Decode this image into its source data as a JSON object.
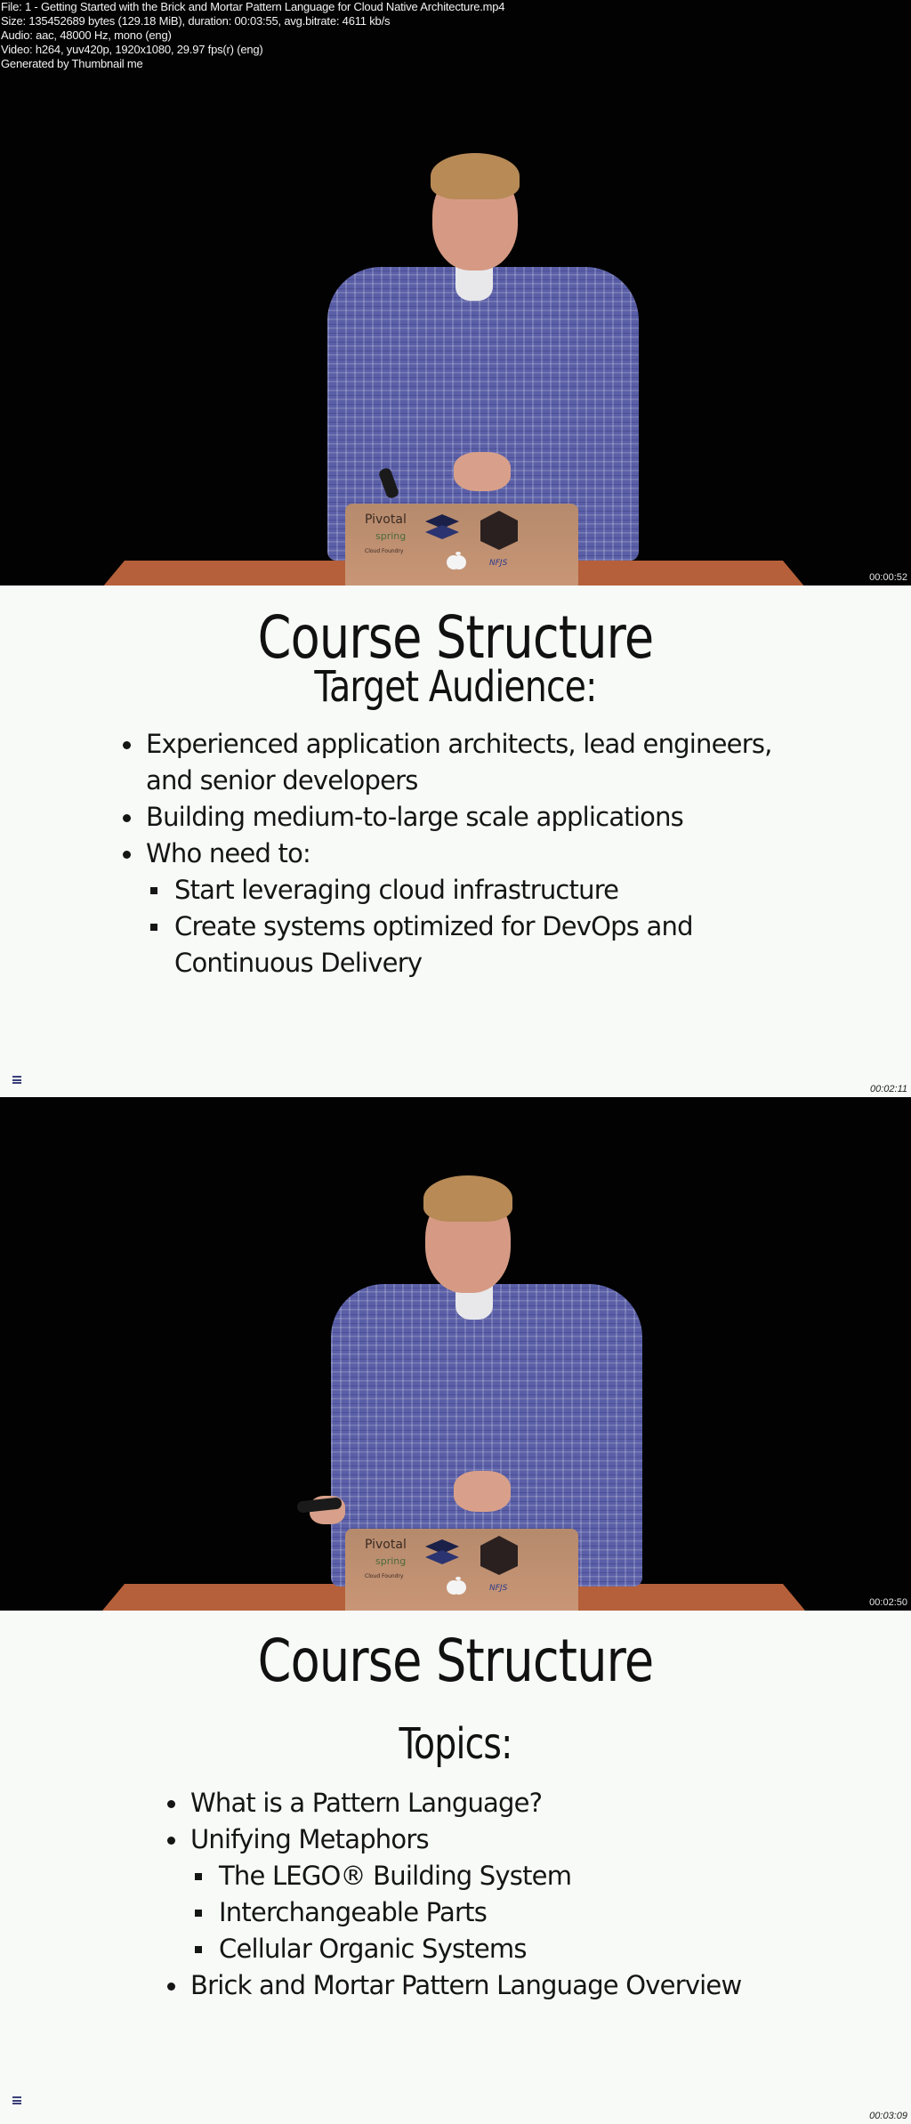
{
  "header": {
    "file_line": "File: 1 - Getting Started with the Brick and Mortar Pattern Language for Cloud Native Architecture.mp4",
    "size_line": "Size: 135452689 bytes (129.18 MiB), duration: 00:03:55, avg.bitrate: 4611 kb/s",
    "audio_line": "Audio: aac, 48000 Hz, mono (eng)",
    "video_line": "Video: h264, yuv420p, 1920x1080, 29.97 fps(r) (eng)",
    "generator_line": "Generated by Thumbnail me"
  },
  "frames": [
    {
      "type": "video",
      "timestamp": "00:00:52",
      "laptop_stickers": [
        "Pivotal",
        "spring",
        "Cloud Foundry",
        "apple-logo",
        "layers-logo",
        "hexagon-badge",
        "NFJS"
      ]
    },
    {
      "type": "slide",
      "timestamp": "00:02:11",
      "title": "Course Structure",
      "subtitle": "Target Audience:",
      "bullets": [
        {
          "level": 1,
          "text": "Experienced application architects, lead engineers,"
        },
        {
          "level": 1,
          "text": "and senior developers",
          "continuation": true
        },
        {
          "level": 1,
          "text": "Building medium-to-large scale applications"
        },
        {
          "level": 1,
          "text": "Who need to:"
        },
        {
          "level": 2,
          "text": "Start leveraging cloud infrastructure"
        },
        {
          "level": 2,
          "text": "Create systems optimized for DevOps and"
        },
        {
          "level": 2,
          "text": "Continuous Delivery",
          "continuation": true
        }
      ],
      "menu_icon": "hamburger-menu-icon"
    },
    {
      "type": "video",
      "timestamp": "00:02:50",
      "laptop_stickers": [
        "Pivotal",
        "spring",
        "Cloud Foundry",
        "apple-logo",
        "layers-logo",
        "hexagon-badge",
        "NFJS"
      ]
    },
    {
      "type": "slide",
      "timestamp": "00:03:09",
      "title": "Course Structure",
      "subtitle": "Topics:",
      "bullets": [
        {
          "level": 1,
          "text": "What is a Pattern Language?"
        },
        {
          "level": 1,
          "text": "Unifying Metaphors"
        },
        {
          "level": 2,
          "text": "The LEGO® Building System"
        },
        {
          "level": 2,
          "text": "Interchangeable Parts"
        },
        {
          "level": 2,
          "text": "Cellular Organic Systems"
        },
        {
          "level": 1,
          "text": "Brick and Mortar Pattern Language Overview"
        }
      ],
      "menu_icon": "hamburger-menu-icon"
    }
  ],
  "colors": {
    "video_background": "#020202",
    "slide_background": "#f8faf8",
    "desk": "#b5603a",
    "shirt": "#5a5fa8",
    "menu_icon": "#3a3f78"
  }
}
